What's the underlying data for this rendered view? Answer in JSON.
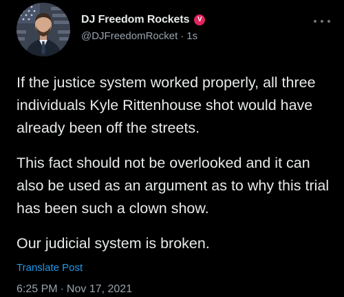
{
  "author": {
    "display_name": "DJ Freedom Rockets",
    "verified_badge_glyph": "V",
    "verified_badge_color": "#e0245e",
    "handle": "@DJFreedomRocket",
    "separator": "·",
    "relative_time": "1s",
    "avatar_icon": "profile-photo-man-suit-flag-background"
  },
  "menu": {
    "more_icon": "ellipsis-icon"
  },
  "tweet": {
    "paragraphs": [
      "If the justice system worked properly, all three individuals Kyle Rittenhouse shot would have already been off the streets.",
      "This fact should not be overlooked and it can also be used as an argument as to why this trial has been such a clown show.",
      "Our judicial system is broken."
    ]
  },
  "translate_label": "Translate Post",
  "timestamp": {
    "time": "6:25 PM",
    "separator": "·",
    "date": "Nov 17, 2021"
  },
  "colors": {
    "background": "#000000",
    "text_primary": "#e7e9ea",
    "text_secondary": "#9aa3ad",
    "link": "#1d9bf0"
  }
}
